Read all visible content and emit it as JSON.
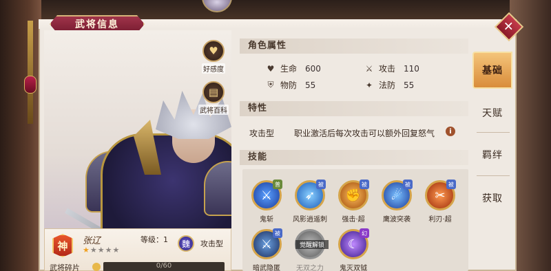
{
  "window": {
    "title": "武将信息",
    "close_symbol": "✕"
  },
  "side_buttons": [
    {
      "label": "好感度",
      "icon": "heart-icon",
      "glyph": "♥"
    },
    {
      "label": "武将百科",
      "icon": "book-icon",
      "glyph": "📖"
    }
  ],
  "hero": {
    "rarity_badge": "神",
    "name": "张辽",
    "level_label": "等级：1",
    "stars_filled": 1,
    "stars_total": 5,
    "star_display": {
      "on": "★",
      "off": "★★★★"
    },
    "faction_badge": "魏",
    "class": "攻击型",
    "fragment_label": "武将碎片",
    "fragment_progress": "0/60",
    "fragment_fraction": 0.0
  },
  "sections": {
    "attributes_title": "角色属性",
    "trait_title": "特性",
    "skills_title": "技能"
  },
  "stats": [
    {
      "label": "生命",
      "value": "600",
      "icon": "heart-icon",
      "glyph": "♥"
    },
    {
      "label": "攻击",
      "value": "110",
      "icon": "sword-icon",
      "glyph": "⚔"
    },
    {
      "label": "物防",
      "value": "55",
      "icon": "shield-icon",
      "glyph": "⛨"
    },
    {
      "label": "法防",
      "value": "55",
      "icon": "magic-shield-icon",
      "glyph": "✦"
    }
  ],
  "trait": {
    "type": "攻击型",
    "description": "职业激活后每次攻击可以额外回复怒气",
    "info_symbol": "i"
  },
  "skills": [
    {
      "name": "鬼斩",
      "tag": "普",
      "color": "#2a5ac8",
      "locked": false
    },
    {
      "name": "风影逍遥刺",
      "tag": "被",
      "color": "#3a7ad8",
      "locked": false
    },
    {
      "name": "强击·超",
      "tag": "被",
      "color": "#d07a1a",
      "locked": false
    },
    {
      "name": "鹰波突袭",
      "tag": "被",
      "color": "#2a6ad0",
      "locked": false
    },
    {
      "name": "利刃·超",
      "tag": "被",
      "color": "#c84a1a",
      "locked": false
    },
    {
      "name": "暗武隐匿",
      "tag": "被",
      "color": "#2a4a8a",
      "locked": false
    },
    {
      "name": "无双之力",
      "tag": "",
      "color": "#7a7a7a",
      "locked": true,
      "lock_label": "觉醒解锁"
    },
    {
      "name": "鬼灭双钺",
      "tag": "幻",
      "color": "#7a3ac8",
      "locked": false
    }
  ],
  "tabs": [
    {
      "label": "基础",
      "active": true
    },
    {
      "label": "天赋",
      "active": false
    },
    {
      "label": "羁绊",
      "active": false
    },
    {
      "label": "获取",
      "active": false
    }
  ]
}
